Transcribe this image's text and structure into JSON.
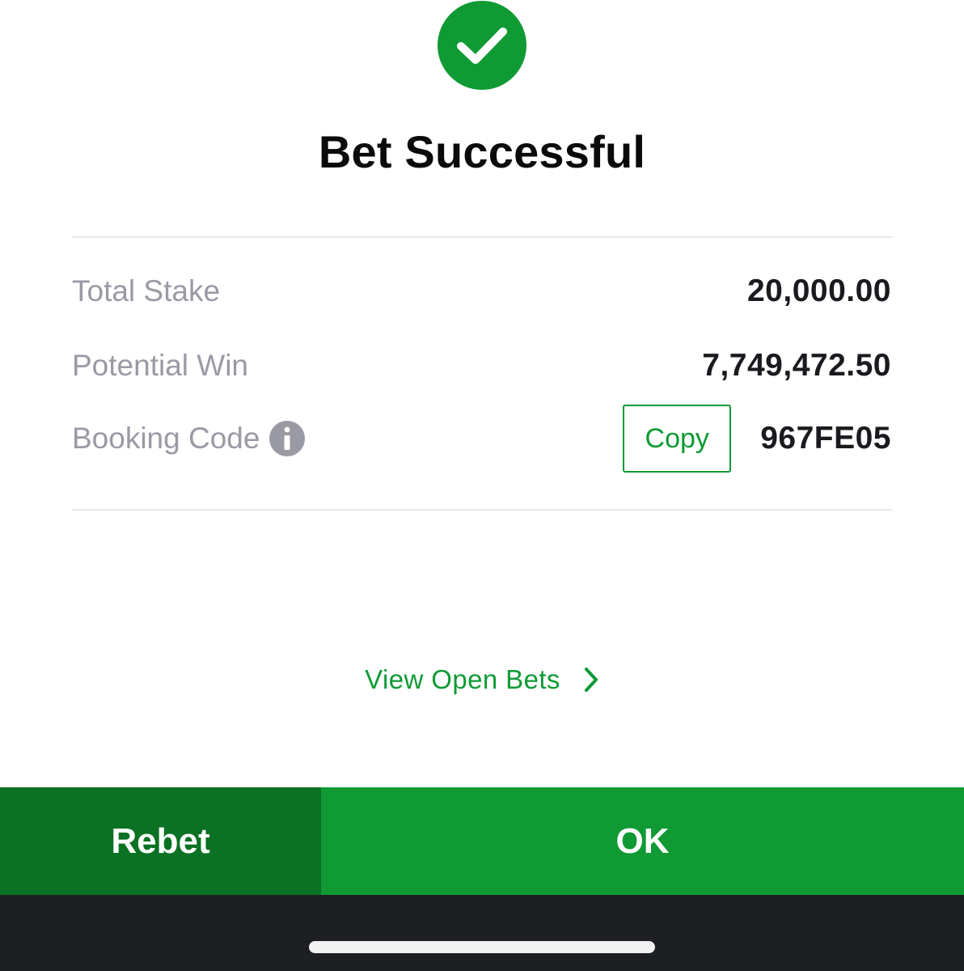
{
  "title": "Bet Successful",
  "icons": {
    "success": "check-circle-icon",
    "info": "info-icon",
    "chevron": "chevron-right-icon"
  },
  "summary": {
    "total_stake_label": "Total Stake",
    "total_stake_value": "20,000.00",
    "potential_win_label": "Potential Win",
    "potential_win_value": "7,749,472.50",
    "booking_code_label": "Booking Code",
    "booking_code_value": "967FE05",
    "copy_label": "Copy"
  },
  "links": {
    "view_open_bets": "View Open Bets"
  },
  "actions": {
    "rebet": "Rebet",
    "ok": "OK"
  },
  "colors": {
    "brand_green": "#0f9a34",
    "dark_green": "#0b7123",
    "label_gray": "#9a9aa5",
    "home_bar_bg": "#1d1f23"
  }
}
